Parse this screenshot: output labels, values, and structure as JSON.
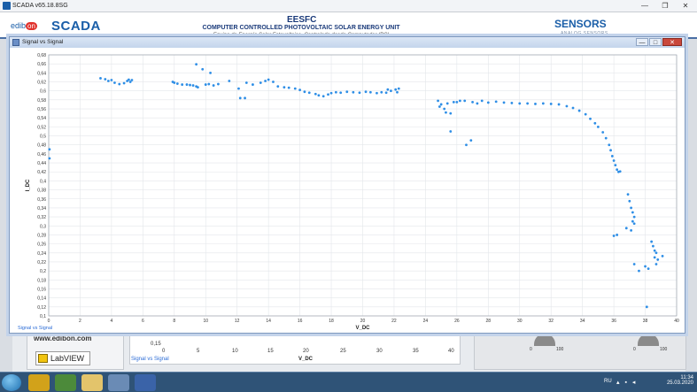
{
  "window": {
    "title": "SCADA v65.18.8SG",
    "controls": [
      "—",
      "❐",
      "✕"
    ]
  },
  "header": {
    "logo_prefix": "edib",
    "logo_on": "on",
    "logo_app": "SCADA",
    "unit_code": "EESFC",
    "unit_name": "COMPUTER CONTROLLED PHOTOVOLTAIC SOLAR ENERGY UNIT",
    "unit_name_es": "Equipo de Energía Solar Fotovoltaica, Controlado desde Computador (PC)",
    "section": "SENSORS",
    "section_sub": "ANALOG SENSORS"
  },
  "dialog": {
    "title": "Signal vs Signal",
    "controls": [
      "—",
      "□",
      "✕"
    ],
    "plot_caption": "Signal vs Signal"
  },
  "background": {
    "website": "www.edibon.com",
    "labview": "LabVIEW",
    "chart2_title": "Signal vs Signal",
    "chart2_ytick": "0,15",
    "chart2_xlabel": "V_DC",
    "chart2_xticks": [
      "0",
      "5",
      "10",
      "15",
      "20",
      "25",
      "30",
      "35",
      "40"
    ],
    "knob1_min": "0",
    "knob1_max": "100",
    "knob2_min": "0",
    "knob2_max": "100"
  },
  "taskbar": {
    "language": "RU",
    "time": "11:34",
    "date": "25.03.2020"
  },
  "chart_data": {
    "type": "scatter",
    "xlabel": "V_DC",
    "ylabel": "I_DC",
    "xlim": [
      0,
      40
    ],
    "ylim": [
      0.1,
      0.68
    ],
    "xticks": [
      0,
      2,
      4,
      6,
      8,
      10,
      12,
      14,
      16,
      18,
      20,
      22,
      24,
      26,
      28,
      30,
      32,
      34,
      36,
      38,
      40
    ],
    "yticks": [
      0.1,
      0.12,
      0.14,
      0.16,
      0.18,
      0.2,
      0.22,
      0.24,
      0.26,
      0.28,
      0.3,
      0.32,
      0.34,
      0.36,
      0.38,
      0.4,
      0.42,
      0.44,
      0.46,
      0.48,
      0.5,
      0.52,
      0.54,
      0.56,
      0.58,
      0.6,
      0.62,
      0.64,
      0.66,
      0.68
    ],
    "grid": true,
    "marker_color": "#2e8ee6",
    "series": [
      {
        "points": [
          [
            0.05,
            0.47
          ],
          [
            0.05,
            0.45
          ],
          [
            3.3,
            0.628
          ],
          [
            3.6,
            0.626
          ],
          [
            3.8,
            0.622
          ],
          [
            4.0,
            0.624
          ],
          [
            4.2,
            0.618
          ],
          [
            4.5,
            0.615
          ],
          [
            4.8,
            0.617
          ],
          [
            5.0,
            0.622
          ],
          [
            5.1,
            0.625
          ],
          [
            5.2,
            0.62
          ],
          [
            5.3,
            0.624
          ],
          [
            7.9,
            0.62
          ],
          [
            8.0,
            0.618
          ],
          [
            8.2,
            0.616
          ],
          [
            8.5,
            0.614
          ],
          [
            8.8,
            0.614
          ],
          [
            9.0,
            0.613
          ],
          [
            9.2,
            0.612
          ],
          [
            9.4,
            0.61
          ],
          [
            9.5,
            0.608
          ],
          [
            9.4,
            0.659
          ],
          [
            9.8,
            0.648
          ],
          [
            10.0,
            0.614
          ],
          [
            10.2,
            0.615
          ],
          [
            10.3,
            0.64
          ],
          [
            10.5,
            0.612
          ],
          [
            10.8,
            0.615
          ],
          [
            11.5,
            0.622
          ],
          [
            12.1,
            0.605
          ],
          [
            12.2,
            0.584
          ],
          [
            12.5,
            0.584
          ],
          [
            12.6,
            0.618
          ],
          [
            13.0,
            0.614
          ],
          [
            13.5,
            0.618
          ],
          [
            13.8,
            0.622
          ],
          [
            14.0,
            0.625
          ],
          [
            14.3,
            0.62
          ],
          [
            14.6,
            0.61
          ],
          [
            15.0,
            0.608
          ],
          [
            15.3,
            0.607
          ],
          [
            15.7,
            0.605
          ],
          [
            16.0,
            0.602
          ],
          [
            16.3,
            0.598
          ],
          [
            16.6,
            0.596
          ],
          [
            17.0,
            0.593
          ],
          [
            17.2,
            0.59
          ],
          [
            17.5,
            0.588
          ],
          [
            17.8,
            0.592
          ],
          [
            18.0,
            0.595
          ],
          [
            18.3,
            0.597
          ],
          [
            18.6,
            0.596
          ],
          [
            19.0,
            0.598
          ],
          [
            19.4,
            0.597
          ],
          [
            19.8,
            0.596
          ],
          [
            20.2,
            0.598
          ],
          [
            20.5,
            0.597
          ],
          [
            20.9,
            0.595
          ],
          [
            21.2,
            0.597
          ],
          [
            21.5,
            0.596
          ],
          [
            21.6,
            0.603
          ],
          [
            21.8,
            0.6
          ],
          [
            22.1,
            0.603
          ],
          [
            22.2,
            0.597
          ],
          [
            22.3,
            0.605
          ],
          [
            24.8,
            0.578
          ],
          [
            24.9,
            0.565
          ],
          [
            25.0,
            0.57
          ],
          [
            25.2,
            0.56
          ],
          [
            25.3,
            0.552
          ],
          [
            25.4,
            0.572
          ],
          [
            25.6,
            0.55
          ],
          [
            25.6,
            0.51
          ],
          [
            25.8,
            0.575
          ],
          [
            26.0,
            0.575
          ],
          [
            26.2,
            0.578
          ],
          [
            26.5,
            0.578
          ],
          [
            26.6,
            0.48
          ],
          [
            26.9,
            0.49
          ],
          [
            27.0,
            0.575
          ],
          [
            27.3,
            0.572
          ],
          [
            27.6,
            0.578
          ],
          [
            28.0,
            0.574
          ],
          [
            28.5,
            0.576
          ],
          [
            29.0,
            0.574
          ],
          [
            29.5,
            0.573
          ],
          [
            30.0,
            0.572
          ],
          [
            30.5,
            0.572
          ],
          [
            31.0,
            0.571
          ],
          [
            31.5,
            0.572
          ],
          [
            32.0,
            0.571
          ],
          [
            32.5,
            0.57
          ],
          [
            33.0,
            0.566
          ],
          [
            33.4,
            0.562
          ],
          [
            33.8,
            0.556
          ],
          [
            34.2,
            0.548
          ],
          [
            34.5,
            0.538
          ],
          [
            34.8,
            0.528
          ],
          [
            35.0,
            0.52
          ],
          [
            35.3,
            0.508
          ],
          [
            35.5,
            0.495
          ],
          [
            35.7,
            0.48
          ],
          [
            35.8,
            0.468
          ],
          [
            35.9,
            0.455
          ],
          [
            36.0,
            0.445
          ],
          [
            36.1,
            0.435
          ],
          [
            36.2,
            0.425
          ],
          [
            36.3,
            0.42
          ],
          [
            36.4,
            0.421
          ],
          [
            36.9,
            0.37
          ],
          [
            37.0,
            0.355
          ],
          [
            37.1,
            0.34
          ],
          [
            37.2,
            0.33
          ],
          [
            37.3,
            0.32
          ],
          [
            37.3,
            0.305
          ],
          [
            37.2,
            0.31
          ],
          [
            37.1,
            0.29
          ],
          [
            36.8,
            0.295
          ],
          [
            36.2,
            0.28
          ],
          [
            36.0,
            0.278
          ],
          [
            37.6,
            0.2
          ],
          [
            37.3,
            0.215
          ],
          [
            38.0,
            0.21
          ],
          [
            38.2,
            0.205
          ],
          [
            38.1,
            0.12
          ],
          [
            38.4,
            0.265
          ],
          [
            38.5,
            0.255
          ],
          [
            38.6,
            0.245
          ],
          [
            38.7,
            0.24
          ],
          [
            38.6,
            0.23
          ],
          [
            38.8,
            0.225
          ],
          [
            38.7,
            0.215
          ],
          [
            39.1,
            0.233
          ]
        ]
      }
    ]
  }
}
